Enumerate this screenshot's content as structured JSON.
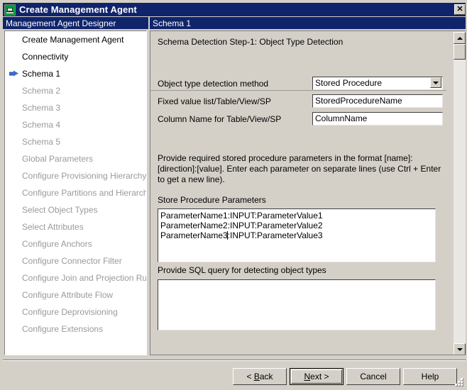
{
  "window": {
    "title": "Create Management Agent",
    "icon": "agent-icon",
    "close_label": "✕"
  },
  "headers": {
    "left": "Management Agent Designer",
    "right": "Schema 1"
  },
  "sidebar": {
    "items": [
      {
        "label": "Create Management Agent",
        "state": "done"
      },
      {
        "label": "Connectivity",
        "state": "done"
      },
      {
        "label": "Schema 1",
        "state": "current"
      },
      {
        "label": "Schema 2",
        "state": "disabled"
      },
      {
        "label": "Schema 3",
        "state": "disabled"
      },
      {
        "label": "Schema 4",
        "state": "disabled"
      },
      {
        "label": "Schema 5",
        "state": "disabled"
      },
      {
        "label": "Global Parameters",
        "state": "disabled"
      },
      {
        "label": "Configure Provisioning Hierarchy",
        "state": "disabled"
      },
      {
        "label": "Configure Partitions and Hierarchies",
        "state": "disabled"
      },
      {
        "label": "Select Object Types",
        "state": "disabled"
      },
      {
        "label": "Select Attributes",
        "state": "disabled"
      },
      {
        "label": "Configure Anchors",
        "state": "disabled"
      },
      {
        "label": "Configure Connector Filter",
        "state": "disabled"
      },
      {
        "label": "Configure Join and Projection Rules",
        "state": "disabled"
      },
      {
        "label": "Configure Attribute Flow",
        "state": "disabled"
      },
      {
        "label": "Configure Deprovisioning",
        "state": "disabled"
      },
      {
        "label": "Configure Extensions",
        "state": "disabled"
      }
    ]
  },
  "main": {
    "step_title": "Schema Detection Step-1:  Object Type Detection",
    "fields": {
      "detection_method_label": "Object type detection method",
      "detection_method_value": "Stored Procedure",
      "fixed_value_label": "Fixed value list/Table/View/SP",
      "fixed_value_value": "StoredProcedureName",
      "column_name_label": "Column Name for Table/View/SP",
      "column_name_value": "ColumnName"
    },
    "help_text": "Provide required stored procedure parameters in the format [name]:[direction]:[value]. Enter each parameter on separate lines (use Ctrl + Enter to get a new line).",
    "params_label": "Store Procedure Parameters",
    "params_line1": "ParameterName1:INPUT:ParameterValue1",
    "params_line2": "ParameterName2:INPUT:ParameterValue2",
    "params_line3_before_caret": "ParameterName3",
    "params_line3_after_caret": ":INPUT:ParameterValue3",
    "sql_label": "Provide SQL query for detecting object types",
    "sql_value": ""
  },
  "footer": {
    "back_prefix": "< ",
    "back_mnemonic": "B",
    "back_suffix": "ack",
    "next_prefix": "",
    "next_mnemonic": "N",
    "next_suffix": "ext >",
    "cancel": "Cancel",
    "help": "Help"
  },
  "colors": {
    "titlebar": "#10246b",
    "face": "#d4d0c8",
    "accent_arrow": "#3a6ecd",
    "disabled_text": "#9a9a9a"
  }
}
